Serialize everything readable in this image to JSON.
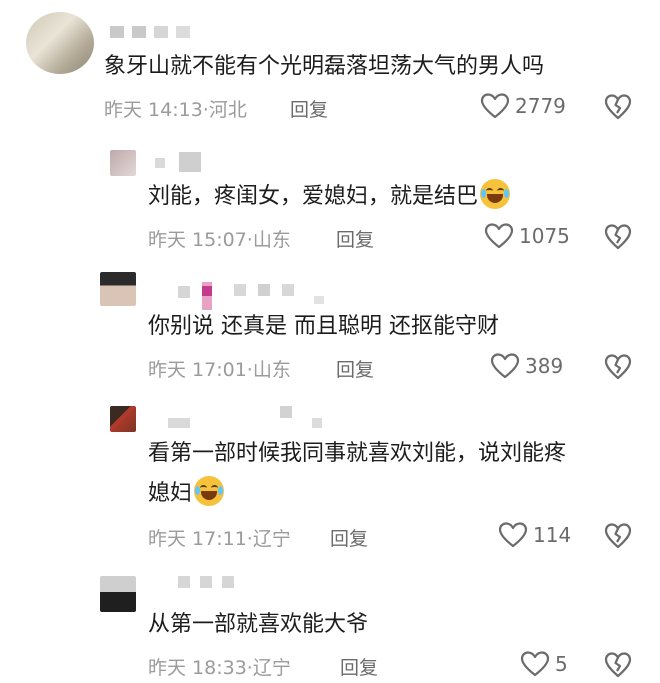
{
  "comments": [
    {
      "text": "象牙山就不能有个光明磊落坦荡大气的男人吗",
      "time": "昨天 14:13",
      "location": "河北",
      "reply_label": "回复",
      "likes": "2779",
      "emoji": ""
    },
    {
      "text": "刘能，疼闺女，爱媳妇，就是结巴",
      "time": "昨天 15:07",
      "location": "山东",
      "reply_label": "回复",
      "likes": "1075",
      "emoji": "laugh-cry-emoji"
    },
    {
      "text": "你别说 还真是 而且聪明 还抠能守财",
      "time": "昨天 17:01",
      "location": "山东",
      "reply_label": "回复",
      "likes": "389",
      "emoji": ""
    },
    {
      "text_line1": "看第一部时候我同事就喜欢刘能，说刘能疼",
      "text_line2": "媳妇",
      "time": "昨天 17:11",
      "location": "辽宁",
      "reply_label": "回复",
      "likes": "114",
      "emoji": "laugh-cry-emoji"
    },
    {
      "text": "从第一部就喜欢能大爷",
      "time": "昨天 18:33",
      "location": "辽宁",
      "reply_label": "回复",
      "likes": "5",
      "emoji": ""
    }
  ],
  "separator": "·",
  "icons": {
    "like": "heart-outline-icon",
    "dislike": "broken-heart-icon"
  },
  "colors": {
    "text": "#1c1c1c",
    "meta": "#9b9b9b",
    "icon": "#6b6b6b"
  }
}
